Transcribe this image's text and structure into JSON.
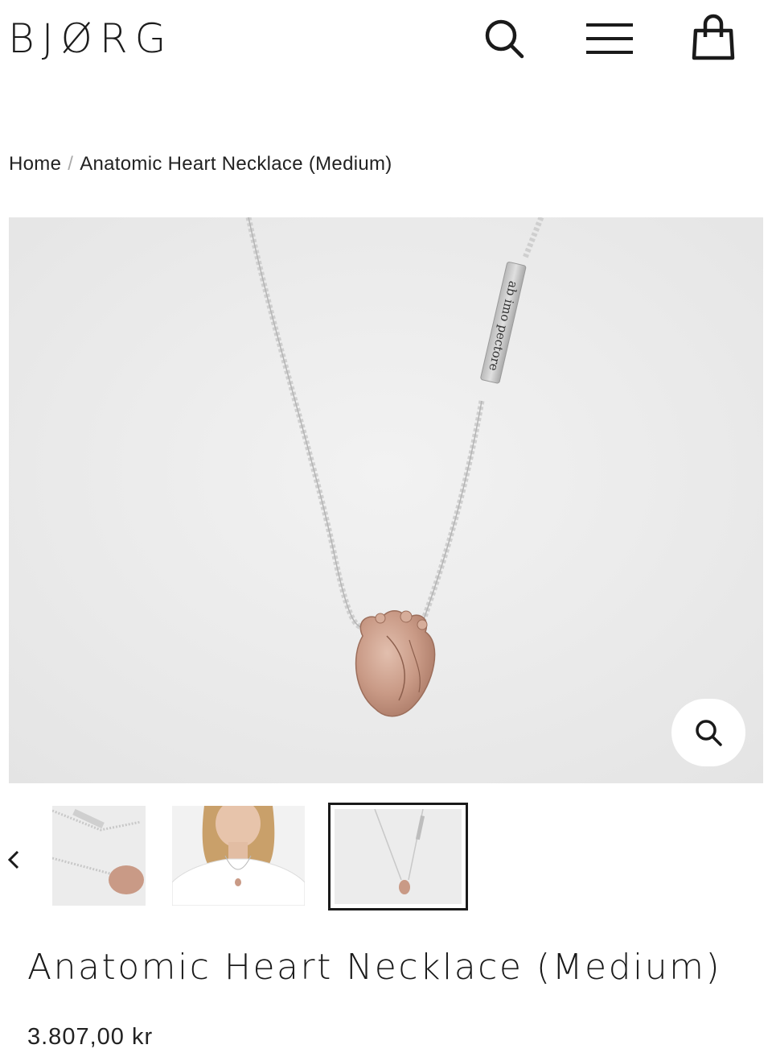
{
  "header": {
    "logo": "BJØRG"
  },
  "breadcrumb": {
    "home": "Home",
    "separator": "/",
    "current": "Anatomic Heart Necklace (Medium)"
  },
  "product": {
    "title": "Anatomic Heart Necklace (Medium)",
    "price": "3.807,00 kr",
    "tag_engraving": "ab imo pectore"
  },
  "icons": {
    "search": "search-icon",
    "menu": "hamburger-menu-icon",
    "cart": "shopping-bag-icon",
    "zoom": "zoom-icon",
    "prev": "chevron-left-icon"
  },
  "colors": {
    "text": "#1a1a1a",
    "image_background": "#ececec",
    "rose_gold": "#c99a86",
    "silver_chain": "#c8c8c8"
  }
}
